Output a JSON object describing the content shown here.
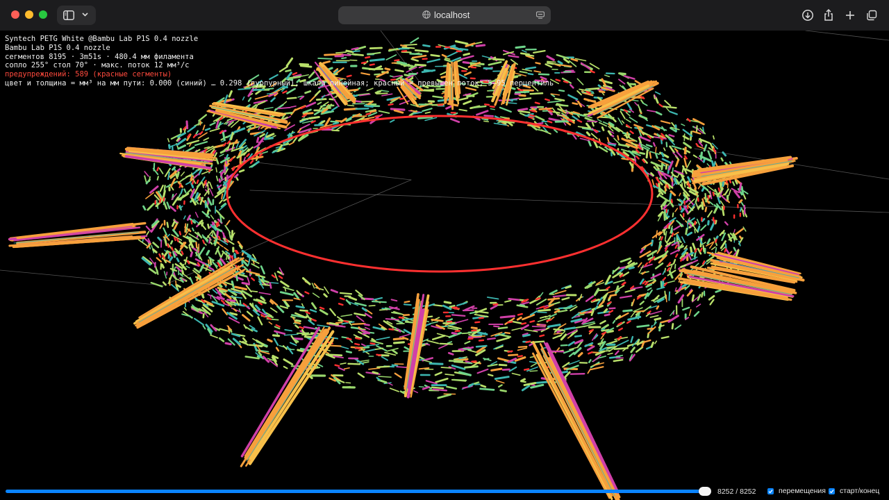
{
  "browser": {
    "url": "localhost",
    "colors": {
      "close": "#fe5f57",
      "minimize": "#febc2e",
      "zoom": "#28c840"
    },
    "icons": [
      "sidebar-icon",
      "chevron-down-icon",
      "globe-icon",
      "reader-icon",
      "download-icon",
      "share-icon",
      "new-tab-icon",
      "tab-overview-icon"
    ]
  },
  "info": {
    "line1": "Syntech PETG White @Bambu Lab P1S 0.4 nozzle",
    "line2": "Bambu Lab P1S 0.4 nozzle",
    "line3": "сегментов 8195 · 3m51s · 480.4 мм филамента",
    "line4": "сопло 255° стол 70° · макс. поток 12 мм³/с",
    "warning": "предупреждений: 589 (красные сегменты)",
    "legend": "цвет и толщина = мм³ на мм пути: 0.000 (синий) … 0.298 (пурпурный), шкала линейная; красный = превышен поток; 5–95 перцентиль"
  },
  "controls": {
    "layer_counter": "8252 / 8252",
    "slider_value": 1.0,
    "travel_label": "перемещения",
    "travel_checked": true,
    "startend_label": "старт/конец",
    "startend_checked": true
  },
  "colors": {
    "accent": "#0a84ff",
    "warning": "#ff4a3d",
    "low_flow": "#3cb6b0",
    "mid_flow": "#b9e06a",
    "high_flow": "#f7a03c",
    "max_flow": "#d040a8",
    "overflow": "#ff3030"
  }
}
